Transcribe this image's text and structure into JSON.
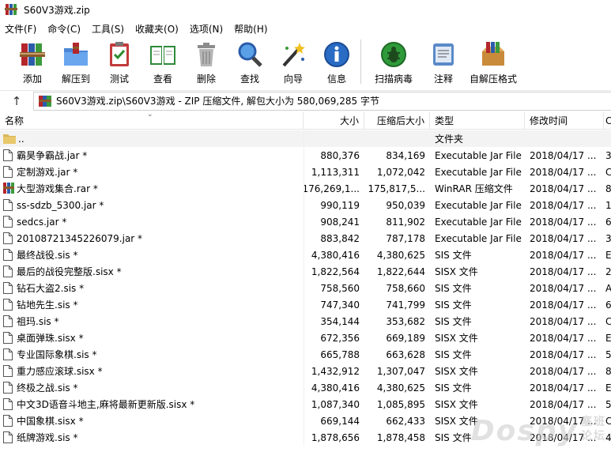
{
  "window": {
    "title": "S60V3游戏.zip"
  },
  "menu": [
    "文件(F)",
    "命令(C)",
    "工具(S)",
    "收藏夹(O)",
    "选项(N)",
    "帮助(H)"
  ],
  "toolbar": [
    {
      "label": "添加",
      "icon": "add-books-icon"
    },
    {
      "label": "解压到",
      "icon": "extract-folder-icon"
    },
    {
      "label": "测试",
      "icon": "test-clipboard-icon"
    },
    {
      "label": "查看",
      "icon": "view-book-icon"
    },
    {
      "label": "删除",
      "icon": "trash-icon"
    },
    {
      "label": "查找",
      "icon": "magnifier-icon"
    },
    {
      "label": "向导",
      "icon": "wizard-wand-icon"
    },
    {
      "label": "信息",
      "icon": "info-icon"
    },
    {
      "label": "扫描病毒",
      "icon": "bug-scan-icon"
    },
    {
      "label": "注释",
      "icon": "comment-icon"
    },
    {
      "label": "自解压格式",
      "icon": "sfx-box-icon"
    }
  ],
  "address": {
    "up_glyph": "↑",
    "path": "S60V3游戏.zip\\S60V3游戏 - ZIP 压缩文件, 解包大小为 580,069,285 字节"
  },
  "columns": {
    "name": "名称",
    "size": "大小",
    "packed": "压缩后大小",
    "type": "类型",
    "modified": "修改时间",
    "crc": "C"
  },
  "parent_row": {
    "name": "..",
    "type": "文件夹"
  },
  "files": [
    {
      "name": "霸昊争霸战.jar *",
      "size": "880,376",
      "packed": "834,169",
      "type": "Executable Jar File",
      "modified": "2018/04/17 ...",
      "crc": "3",
      "kind": "file"
    },
    {
      "name": "定制游戏.jar *",
      "size": "1,113,311",
      "packed": "1,072,042",
      "type": "Executable Jar File",
      "modified": "2018/04/17 ...",
      "crc": "C",
      "kind": "file"
    },
    {
      "name": "大型游戏集合.rar *",
      "size": "176,269,1...",
      "packed": "175,817,5...",
      "type": "WinRAR 压缩文件",
      "modified": "2018/04/17 ...",
      "crc": "8",
      "kind": "rar"
    },
    {
      "name": "ss-sdzb_5300.jar *",
      "size": "990,119",
      "packed": "950,039",
      "type": "Executable Jar File",
      "modified": "2018/04/17 ...",
      "crc": "1",
      "kind": "file"
    },
    {
      "name": "sedcs.jar *",
      "size": "908,241",
      "packed": "811,902",
      "type": "Executable Jar File",
      "modified": "2018/04/17 ...",
      "crc": "6",
      "kind": "file"
    },
    {
      "name": "20108721345226079.jar *",
      "size": "883,842",
      "packed": "787,178",
      "type": "Executable Jar File",
      "modified": "2018/04/17 ...",
      "crc": "3",
      "kind": "file"
    },
    {
      "name": "最终战役.sis *",
      "size": "4,380,416",
      "packed": "4,380,625",
      "type": "SIS 文件",
      "modified": "2018/04/17 ...",
      "crc": "E",
      "kind": "file"
    },
    {
      "name": "最后的战役完整版.sisx *",
      "size": "1,822,564",
      "packed": "1,822,644",
      "type": "SISX 文件",
      "modified": "2018/04/17 ...",
      "crc": "2",
      "kind": "file"
    },
    {
      "name": "钻石大盗2.sis *",
      "size": "758,560",
      "packed": "758,660",
      "type": "SIS 文件",
      "modified": "2018/04/17 ...",
      "crc": "A",
      "kind": "file"
    },
    {
      "name": "钻地先生.sis *",
      "size": "747,340",
      "packed": "741,799",
      "type": "SIS 文件",
      "modified": "2018/04/17 ...",
      "crc": "6",
      "kind": "file"
    },
    {
      "name": "祖玛.sis *",
      "size": "354,144",
      "packed": "353,682",
      "type": "SIS 文件",
      "modified": "2018/04/17 ...",
      "crc": "C",
      "kind": "file"
    },
    {
      "name": "桌面弹珠.sisx *",
      "size": "672,356",
      "packed": "669,189",
      "type": "SISX 文件",
      "modified": "2018/04/17 ...",
      "crc": "E",
      "kind": "file"
    },
    {
      "name": "专业国际象棋.sis *",
      "size": "665,788",
      "packed": "663,628",
      "type": "SIS 文件",
      "modified": "2018/04/17 ...",
      "crc": "5",
      "kind": "file"
    },
    {
      "name": "重力感应滚球.sisx *",
      "size": "1,432,912",
      "packed": "1,307,047",
      "type": "SISX 文件",
      "modified": "2018/04/17 ...",
      "crc": "8",
      "kind": "file"
    },
    {
      "name": "终极之战.sis *",
      "size": "4,380,416",
      "packed": "4,380,625",
      "type": "SIS 文件",
      "modified": "2018/04/17 ...",
      "crc": "E",
      "kind": "file"
    },
    {
      "name": "中文3D语音斗地主,麻将最新更新版.sisx *",
      "size": "1,087,340",
      "packed": "1,085,895",
      "type": "SISX 文件",
      "modified": "2018/04/17 ...",
      "crc": "5",
      "kind": "file"
    },
    {
      "name": "中国象棋.sisx *",
      "size": "669,144",
      "packed": "662,433",
      "type": "SISX 文件",
      "modified": "2018/04/17 ...",
      "crc": "C",
      "kind": "file"
    },
    {
      "name": "纸牌游戏.sis *",
      "size": "1,878,656",
      "packed": "1,878,458",
      "type": "SIS 文件",
      "modified": "2018/04/17 ...",
      "crc": "4",
      "kind": "file"
    }
  ],
  "watermark": {
    "main": "Dospy",
    "sub": "塞班\n论坛"
  },
  "colors": {
    "folder": "#d8b65a",
    "selection_row": "#f3f3f3",
    "header_border": "#e5e5e5"
  }
}
